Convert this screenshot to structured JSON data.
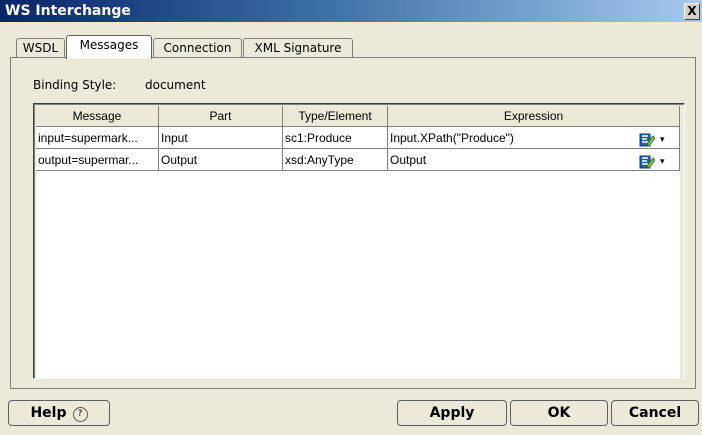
{
  "window": {
    "title": "WS Interchange",
    "close_label": "X"
  },
  "tabs": [
    {
      "label": "WSDL"
    },
    {
      "label": "Messages"
    },
    {
      "label": "Connection"
    },
    {
      "label": "XML Signature"
    }
  ],
  "binding": {
    "label": "Binding Style:",
    "value": "document"
  },
  "table": {
    "columns": [
      "Message",
      "Part",
      "Type/Element",
      "Expression"
    ],
    "rows": [
      {
        "message": "input=supermark...",
        "part": "Input",
        "type": "sc1:Produce",
        "expression": "Input.XPath(\"Produce\")",
        "edit_icon": "edit-expression-icon"
      },
      {
        "message": "output=supermar...",
        "part": "Output",
        "type": "xsd:AnyType",
        "expression": "Output",
        "edit_icon": "edit-expression-icon"
      }
    ]
  },
  "buttons": {
    "help": "Help",
    "help_glyph": "?",
    "apply": "Apply",
    "ok": "OK",
    "cancel": "Cancel"
  },
  "colors": {
    "titlebar_start": "#0a246a",
    "dialog_bg": "#ece9d8"
  }
}
